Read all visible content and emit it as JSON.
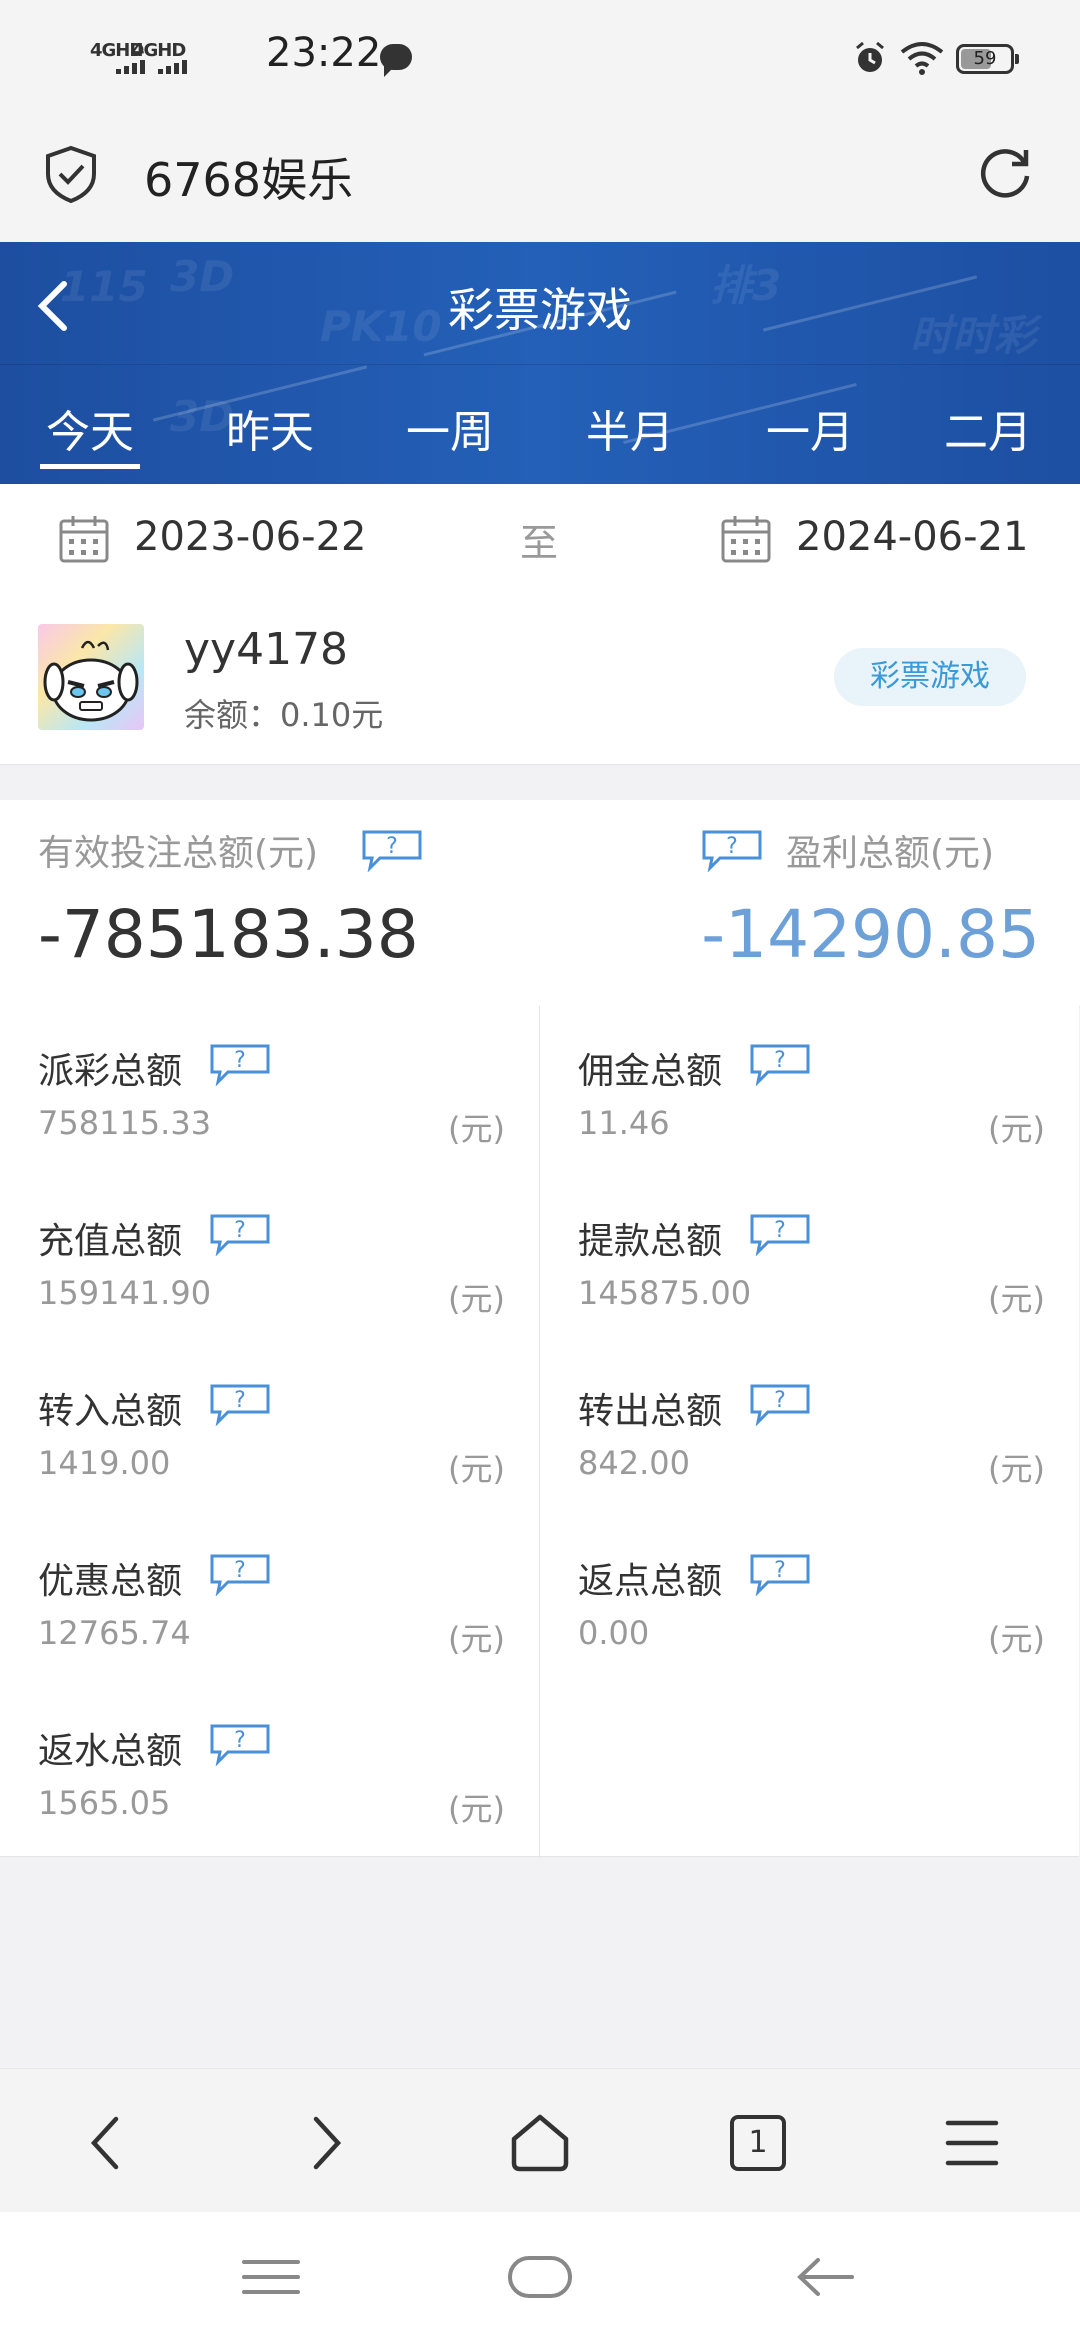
{
  "status_bar": {
    "signal1": "4GHD",
    "signal2": "4GHD",
    "time": "23:22",
    "battery": "59"
  },
  "browser": {
    "site_title": "6768娱乐"
  },
  "header": {
    "title": "彩票游戏",
    "tabs": [
      "今天",
      "昨天",
      "一周",
      "半月",
      "一月",
      "二月"
    ],
    "active_tab": "今天"
  },
  "date_range": {
    "start": "2023-06-22",
    "separator": "至",
    "end": "2024-06-21"
  },
  "user": {
    "name": "yy4178",
    "balance": "余额：0.10元",
    "badge": "彩票游戏"
  },
  "summary": {
    "bet_label": "有效投注总额(元)",
    "bet_value": "-785183.38",
    "profit_label": "盈利总额(元)",
    "profit_value": "-14290.85"
  },
  "stats": {
    "unit": "(元)",
    "items": [
      {
        "label": "派彩总额",
        "value": "758115.33"
      },
      {
        "label": "佣金总额",
        "value": "11.46"
      },
      {
        "label": "充值总额",
        "value": "159141.90"
      },
      {
        "label": "提款总额",
        "value": "145875.00"
      },
      {
        "label": "转入总额",
        "value": "1419.00"
      },
      {
        "label": "转出总额",
        "value": "842.00"
      },
      {
        "label": "优惠总额",
        "value": "12765.74"
      },
      {
        "label": "返点总额",
        "value": "0.00"
      },
      {
        "label": "返水总额",
        "value": "1565.05"
      }
    ]
  },
  "bottom_nav": {
    "tab_count": "1",
    "icons": [
      "back-icon",
      "forward-icon",
      "home-icon",
      "tabs-icon",
      "menu-icon"
    ]
  },
  "colors": {
    "header_blue": "#2460b8",
    "profit_blue": "#6ea0d8",
    "badge_text": "#3a9ad8",
    "help_icon": "#4a90d9"
  }
}
